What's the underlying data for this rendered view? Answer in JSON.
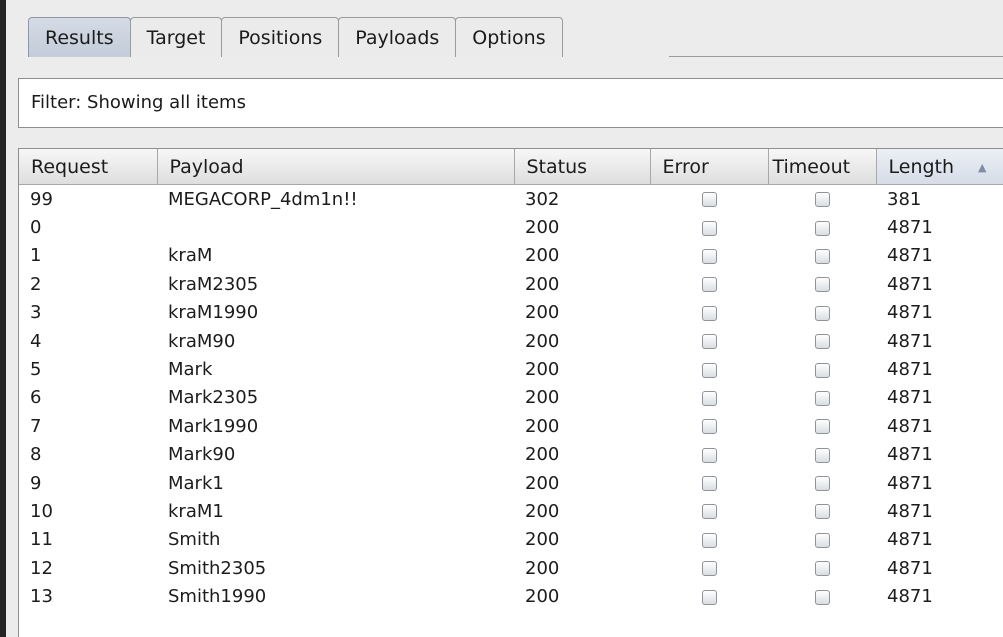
{
  "tabs": [
    {
      "label": "Results",
      "active": true
    },
    {
      "label": "Target"
    },
    {
      "label": "Positions"
    },
    {
      "label": "Payloads"
    },
    {
      "label": "Options"
    }
  ],
  "filter": {
    "text": "Filter: Showing all items"
  },
  "table": {
    "columns": [
      "Request",
      "Payload",
      "Status",
      "Error",
      "Timeout",
      "Length"
    ],
    "sort": {
      "column": "Length",
      "direction": "ascending"
    },
    "rows": [
      {
        "request": "99",
        "payload": "MEGACORP_4dm1n!!",
        "status": "302",
        "error": false,
        "timeout": false,
        "length": "381"
      },
      {
        "request": "0",
        "payload": "",
        "status": "200",
        "error": false,
        "timeout": false,
        "length": "4871"
      },
      {
        "request": "1",
        "payload": "kraM",
        "status": "200",
        "error": false,
        "timeout": false,
        "length": "4871"
      },
      {
        "request": "2",
        "payload": "kraM2305",
        "status": "200",
        "error": false,
        "timeout": false,
        "length": "4871"
      },
      {
        "request": "3",
        "payload": "kraM1990",
        "status": "200",
        "error": false,
        "timeout": false,
        "length": "4871"
      },
      {
        "request": "4",
        "payload": "kraM90",
        "status": "200",
        "error": false,
        "timeout": false,
        "length": "4871"
      },
      {
        "request": "5",
        "payload": "Mark",
        "status": "200",
        "error": false,
        "timeout": false,
        "length": "4871"
      },
      {
        "request": "6",
        "payload": "Mark2305",
        "status": "200",
        "error": false,
        "timeout": false,
        "length": "4871"
      },
      {
        "request": "7",
        "payload": "Mark1990",
        "status": "200",
        "error": false,
        "timeout": false,
        "length": "4871"
      },
      {
        "request": "8",
        "payload": "Mark90",
        "status": "200",
        "error": false,
        "timeout": false,
        "length": "4871"
      },
      {
        "request": "9",
        "payload": "Mark1",
        "status": "200",
        "error": false,
        "timeout": false,
        "length": "4871"
      },
      {
        "request": "10",
        "payload": "kraM1",
        "status": "200",
        "error": false,
        "timeout": false,
        "length": "4871"
      },
      {
        "request": "11",
        "payload": "Smith",
        "status": "200",
        "error": false,
        "timeout": false,
        "length": "4871"
      },
      {
        "request": "12",
        "payload": "Smith2305",
        "status": "200",
        "error": false,
        "timeout": false,
        "length": "4871"
      },
      {
        "request": "13",
        "payload": "Smith1990",
        "status": "200",
        "error": false,
        "timeout": false,
        "length": "4871"
      }
    ]
  }
}
